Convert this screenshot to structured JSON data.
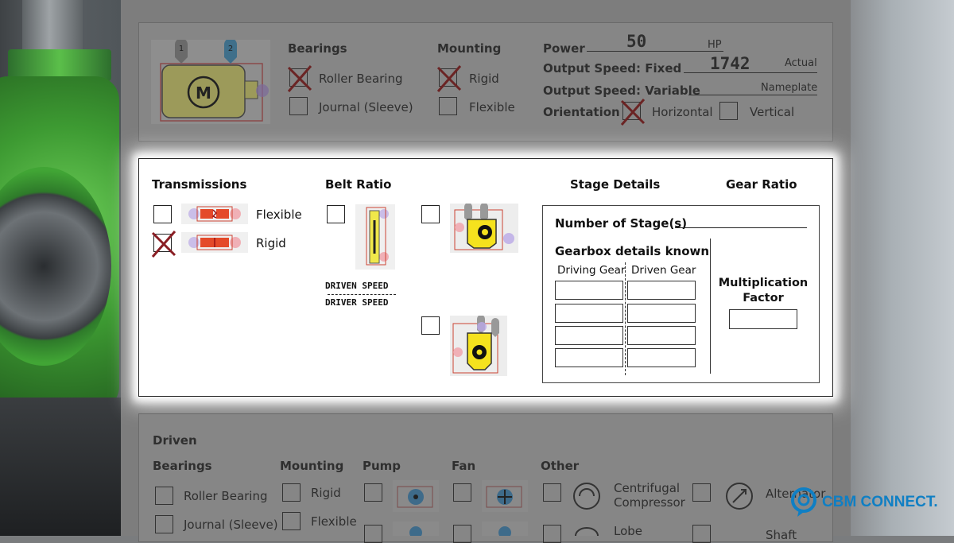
{
  "top_panel": {
    "bearings": {
      "title": "Bearings",
      "options": [
        {
          "label": "Roller Bearing",
          "checked": true
        },
        {
          "label": "Journal (Sleeve)",
          "checked": false
        }
      ]
    },
    "mounting": {
      "title": "Mounting",
      "options": [
        {
          "label": "Rigid",
          "checked": true
        },
        {
          "label": "Flexible",
          "checked": false
        }
      ]
    },
    "motor_letter": "M",
    "pin_labels": [
      "1",
      "2"
    ],
    "power_label": "Power",
    "power_value": "50",
    "power_unit": "HP",
    "speed_fixed_label": "Output Speed: Fixed",
    "speed_fixed_value": "1742",
    "speed_fixed_unit": "Actual",
    "speed_variable_label": "Output Speed: Variable",
    "speed_variable_unit": "Nameplate",
    "orientation_label": "Orientation",
    "orientation_options": [
      {
        "label": "Horizontal",
        "checked": true
      },
      {
        "label": "Vertical",
        "checked": false
      }
    ]
  },
  "transmission_panel": {
    "transmissions_title": "Transmissions",
    "transmissions": [
      {
        "label": "Flexible",
        "checked": false
      },
      {
        "label": "Rigid",
        "checked": true
      }
    ],
    "belt_ratio_title": "Belt Ratio",
    "ratio_numerator": "DRIVEN SPEED",
    "ratio_denominator": "DRIVER SPEED",
    "stage_details_title": "Stage Details",
    "gear_ratio_title": "Gear Ratio",
    "number_of_stages_label": "Number of Stage(s)",
    "gearbox_known_label": "Gearbox details known",
    "driving_gear_label": "Driving Gear",
    "driven_gear_label": "Driven Gear",
    "multiplication_factor_label": "Multiplication Factor"
  },
  "bottom_panel": {
    "driven_title": "Driven",
    "bearings_title": "Bearings",
    "bearings": [
      "Roller Bearing",
      "Journal (Sleeve)"
    ],
    "mounting_title": "Mounting",
    "mounting": [
      "Rigid",
      "Flexible"
    ],
    "pump_title": "Pump",
    "fan_title": "Fan",
    "other_title": "Other",
    "other_items": [
      "Centrifugal Compressor",
      "Lobe",
      "Alternator",
      "Shaft"
    ]
  },
  "brand": {
    "name": "CBM CONNECT.",
    "color": "#0f7fc4"
  }
}
